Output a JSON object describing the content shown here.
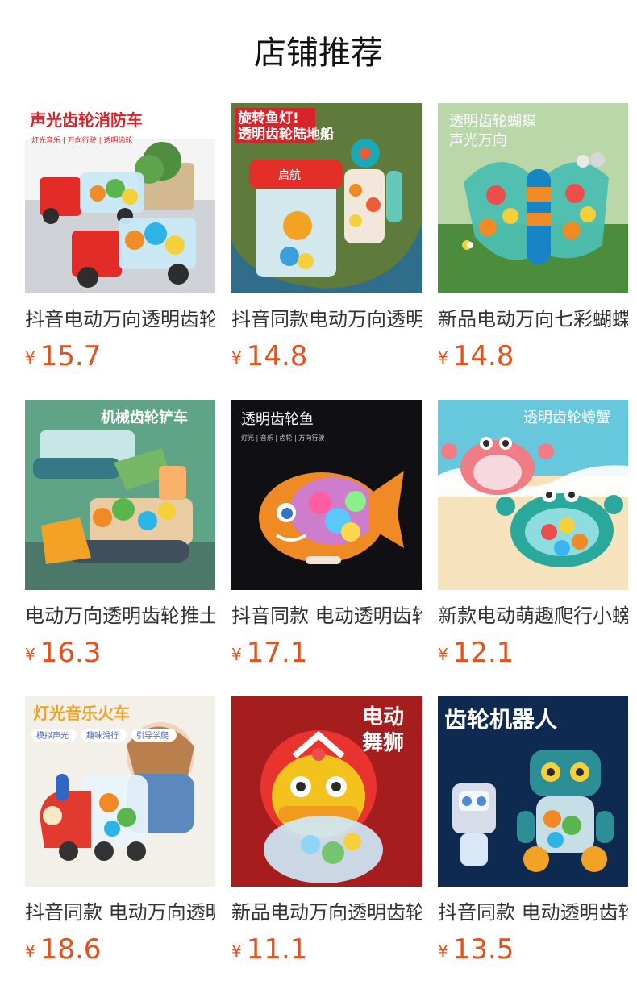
{
  "page": {
    "title": "店铺推荐",
    "currency_symbol": "¥"
  },
  "colors": {
    "price": "#e4511a",
    "text": "#333333",
    "title": "#111111"
  },
  "products": [
    {
      "name": "抖音电动万向透明齿轮消防车",
      "price": "15.7",
      "image": {
        "name": "fire-truck-image",
        "headline": "声光齿轮消防车",
        "subline": "灯光音乐 | 万向行驶 | 透明齿轮",
        "bg": "#f4f4f4",
        "accent": "#d8232a"
      }
    },
    {
      "name": "抖音同款电动万向透明齿轮陆地船",
      "price": "14.8",
      "image": {
        "name": "land-ship-image",
        "headline1": "旋转鱼灯!",
        "headline2": "透明齿轮陆地船",
        "bg": "#6e8f43",
        "accent": "#d8232a"
      }
    },
    {
      "name": "新品电动万向七彩蝴蝶玩具",
      "price": "14.8",
      "image": {
        "name": "butterfly-image",
        "headline1": "透明齿轮蝴蝶",
        "headline2": "声光万向",
        "bg": "#b9d7a8",
        "accent": "#4bbfb0"
      }
    },
    {
      "name": "电动万向透明齿轮推土机",
      "price": "16.3",
      "image": {
        "name": "bulldozer-image",
        "headline": "机械齿轮铲车",
        "bg": "#5fa487",
        "accent": "#f2a326"
      }
    },
    {
      "name": "抖音同款 电动透明齿轮鱼",
      "price": "17.1",
      "image": {
        "name": "fish-image",
        "headline": "透明齿轮鱼",
        "subline": "灯光 | 音乐 | 齿轮 | 万向行驶",
        "bg": "#0f0f14",
        "accent": "#f08a24"
      }
    },
    {
      "name": "新款电动萌趣爬行小螃蟹",
      "price": "12.1",
      "image": {
        "name": "crab-image",
        "headline": "透明齿轮螃蟹",
        "bg": "#f6e3bd",
        "accent": "#f07c86"
      }
    },
    {
      "name": "抖音同款 电动万向透明齿轮火车",
      "price": "18.6",
      "image": {
        "name": "train-image",
        "headline": "灯光音乐火车",
        "tags": [
          "模拟声光",
          "趣味滑行",
          "引导学爬"
        ],
        "bg": "#e9eef5",
        "accent": "#e33a2f"
      }
    },
    {
      "name": "新品电动万向透明齿轮舞狮",
      "price": "11.1",
      "image": {
        "name": "lion-dance-image",
        "headline1": "电动",
        "headline2": "舞狮",
        "bg": "#a61d1d",
        "accent": "#f4c21c"
      }
    },
    {
      "name": "抖音同款 电动透明齿轮机器人",
      "price": "13.5",
      "image": {
        "name": "robot-image",
        "headline": "齿轮机器人",
        "bg": "#0e2747",
        "accent": "#f2a326"
      }
    }
  ]
}
